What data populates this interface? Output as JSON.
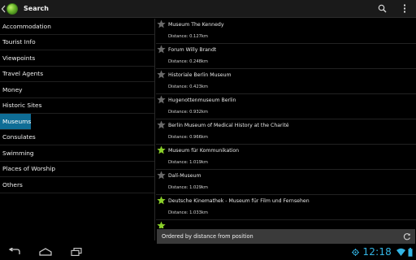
{
  "actionbar": {
    "title": "Search",
    "icons": [
      "up-caret-icon",
      "app-globe-icon",
      "search-icon",
      "overflow-menu-icon"
    ]
  },
  "categories": [
    {
      "label": "Accommodation",
      "selected": false
    },
    {
      "label": "Tourist Info",
      "selected": false
    },
    {
      "label": "Viewpoints",
      "selected": false
    },
    {
      "label": "Travel Agents",
      "selected": false
    },
    {
      "label": "Money",
      "selected": false
    },
    {
      "label": "Historic Sites",
      "selected": false
    },
    {
      "label": "Museums",
      "selected": true
    },
    {
      "label": "Consulates",
      "selected": false
    },
    {
      "label": "Swimming",
      "selected": false
    },
    {
      "label": "Places of Worship",
      "selected": false
    },
    {
      "label": "Others",
      "selected": false
    }
  ],
  "results": [
    {
      "name": "Museum The Kennedy",
      "distance": "Distance: 0.127km",
      "favorite": false
    },
    {
      "name": "Forum Willy Brandt",
      "distance": "Distance: 0.248km",
      "favorite": false
    },
    {
      "name": "Historiale Berlin Museum",
      "distance": "Distance: 0.423km",
      "favorite": false
    },
    {
      "name": "Hugenottenmuseum Berlin",
      "distance": "Distance: 0.932km",
      "favorite": false
    },
    {
      "name": "Berlin Museum of Medical History at the Charité",
      "distance": "Distance: 0.966km",
      "favorite": false
    },
    {
      "name": "Museum für Kommunikation",
      "distance": "Distance: 1.019km",
      "favorite": true
    },
    {
      "name": "Dalí-Museum",
      "distance": "Distance: 1.029km",
      "favorite": false
    },
    {
      "name": "Deutsche Kinemathek - Museum für Film und Fernsehen",
      "distance": "Distance: 1.033km",
      "favorite": true
    },
    {
      "name": "",
      "distance": "",
      "favorite": true
    }
  ],
  "sortbar": {
    "label": "Ordered by distance from position",
    "icon": "refresh-icon"
  },
  "navbar": {
    "time": "12:18",
    "icons": [
      "back-icon",
      "home-icon",
      "recent-apps-icon",
      "location-icon",
      "wifi-icon",
      "battery-icon"
    ]
  },
  "colors": {
    "accent_blue": "#33b5e5",
    "selected_bg": "#0f6d96",
    "star_on": "#8bd12a",
    "star_off": "#6a6a6a"
  }
}
